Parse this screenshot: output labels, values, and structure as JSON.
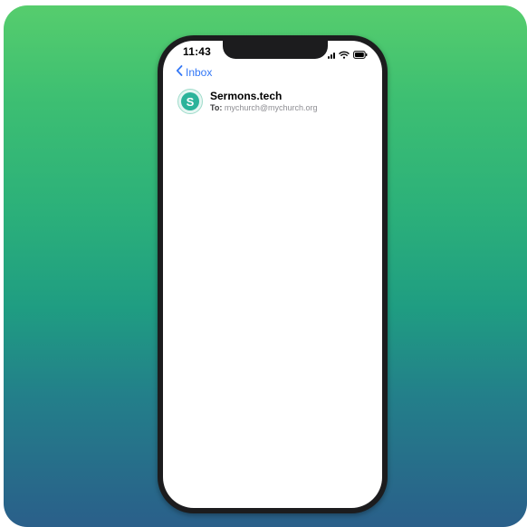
{
  "status_bar": {
    "time": "11:43"
  },
  "nav": {
    "back_label": "Inbox"
  },
  "email": {
    "avatar_letter": "S",
    "sender_name": "Sermons.tech",
    "to_label": "To:",
    "to_address": "mychurch@mychurch.org"
  },
  "colors": {
    "accent": "#3478f6",
    "brand": "#2bb39a",
    "gradient_top": "#56cd6d",
    "gradient_bottom": "#2a5f8a"
  },
  "icons": [
    "chevron-left-icon",
    "signal-icon",
    "wifi-icon",
    "battery-icon"
  ]
}
